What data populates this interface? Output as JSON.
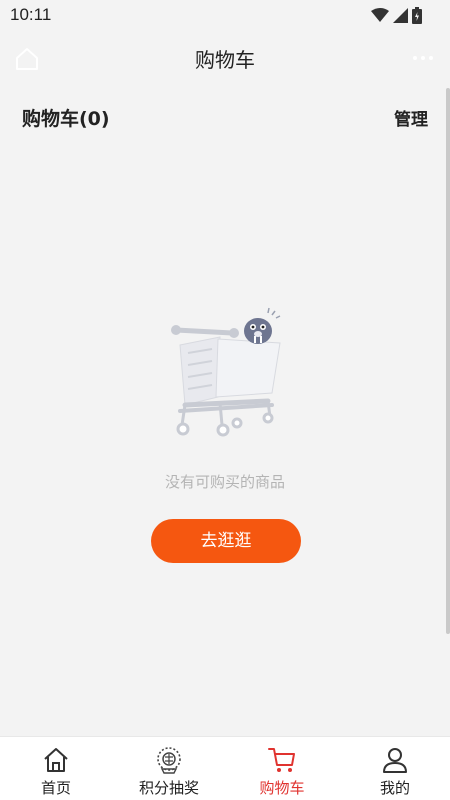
{
  "status_bar": {
    "time": "10:11"
  },
  "nav": {
    "title": "购物车",
    "home_icon": "home-outline-icon",
    "more_icon": "more-dots-icon"
  },
  "cart_header": {
    "title": "购物车(0)",
    "manage_label": "管理"
  },
  "empty_state": {
    "illustration": "empty-cart-illustration",
    "message": "没有可购买的商品",
    "button_label": "去逛逛",
    "button_color": "#f55710"
  },
  "tab_bar": {
    "active_color": "#e0332f",
    "items": [
      {
        "label": "首页",
        "icon": "home-icon",
        "active": false
      },
      {
        "label": "积分抽奖",
        "icon": "lottery-icon",
        "active": false
      },
      {
        "label": "购物车",
        "icon": "cart-icon",
        "active": true
      },
      {
        "label": "我的",
        "icon": "user-icon",
        "active": false
      }
    ]
  }
}
